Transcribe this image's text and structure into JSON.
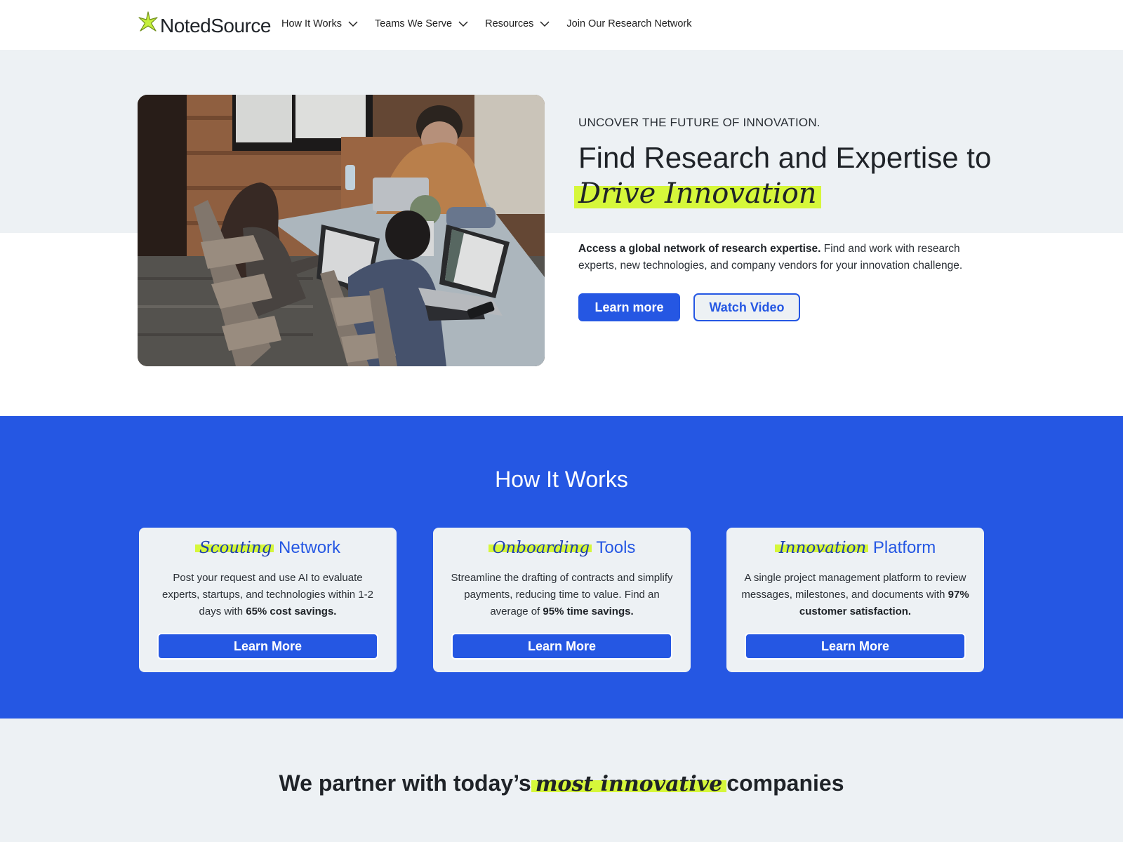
{
  "brand": {
    "name": "NotedSource",
    "accent_color": "#2557e3",
    "highlight_color": "#d6f73a",
    "logo_icon": "star-icon"
  },
  "nav": {
    "items": [
      {
        "label": "How It Works",
        "has_dropdown": true
      },
      {
        "label": "Teams We Serve",
        "has_dropdown": true
      },
      {
        "label": "Resources",
        "has_dropdown": true
      },
      {
        "label": "Join Our Research Network",
        "has_dropdown": false
      }
    ]
  },
  "hero": {
    "eyebrow": "UNCOVER THE FUTURE OF INNOVATION.",
    "headline_plain": "Find Research and Expertise to",
    "headline_highlight": "Drive Innovation",
    "description_bold": "Access a global network of research expertise.",
    "description_rest": " Find and work with research experts, new technologies, and company vendors for your innovation challenge.",
    "image_alt": "Three people working on laptops at a wooden table",
    "primary_button": "Learn more",
    "secondary_button": "Watch Video"
  },
  "how_it_works": {
    "title": "How It Works",
    "cards": [
      {
        "title_highlight": "Scouting",
        "title_rest": "Network",
        "desc_plain": "Post your request and use AI to evaluate experts, startups, and technologies within 1-2 days with ",
        "desc_bold": "65% cost savings.",
        "button": "Learn More"
      },
      {
        "title_highlight": "Onboarding",
        "title_rest": "Tools",
        "desc_plain": "Streamline the drafting of contracts and simplify payments, reducing time to value. Find an average of ",
        "desc_bold": "95% time savings.",
        "button": "Learn More"
      },
      {
        "title_highlight": "Innovation",
        "title_rest": "Platform",
        "desc_plain": "A single project management platform to review messages, milestones, and documents with ",
        "desc_bold": "97% customer satisfaction.",
        "button": "Learn More"
      }
    ]
  },
  "partners": {
    "title_before": "We partner with today’s",
    "title_highlight": "most innovative",
    "title_after": "companies"
  }
}
